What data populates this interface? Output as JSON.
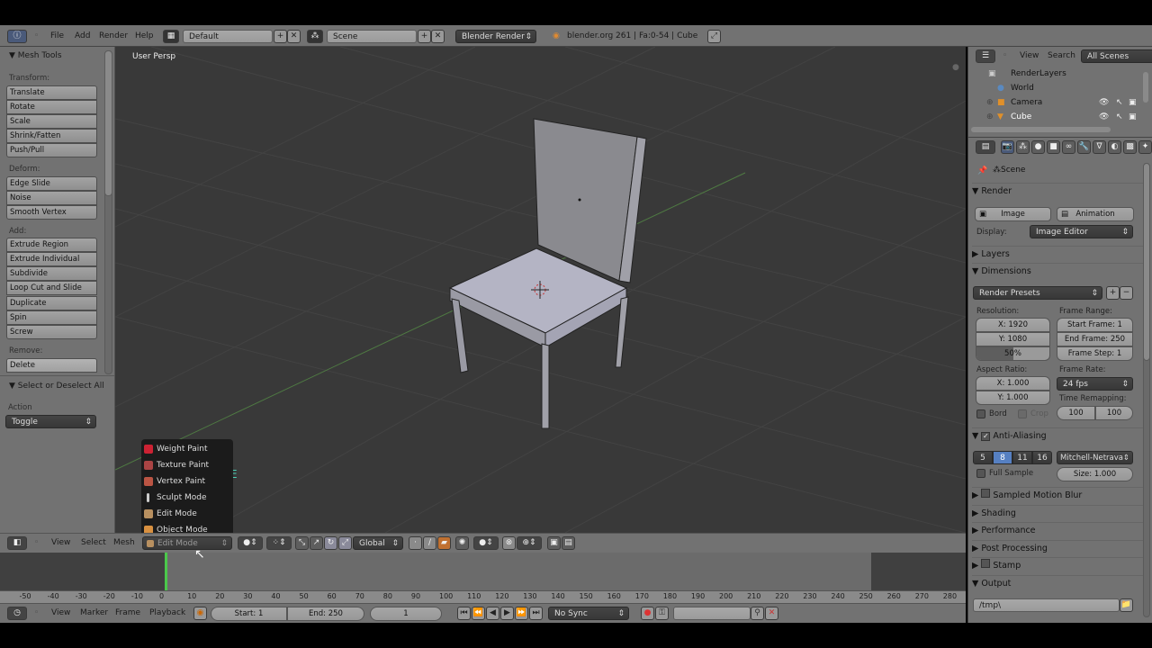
{
  "top_header": {
    "menus": [
      "File",
      "Add",
      "Render",
      "Help"
    ],
    "screen_layout": "Default",
    "scene": "Scene",
    "render_engine": "Blender Render",
    "info_text": "blender.org 261 | Fa:0-54 | Cube"
  },
  "tool_shelf": {
    "title": "Mesh Tools",
    "sections": [
      {
        "label": "Transform:",
        "buttons": [
          "Translate",
          "Rotate",
          "Scale",
          "Shrink/Fatten",
          "Push/Pull"
        ]
      },
      {
        "label": "Deform:",
        "buttons": [
          "Edge Slide",
          "Noise",
          "Smooth Vertex"
        ]
      },
      {
        "label": "Add:",
        "buttons": [
          "Extrude Region",
          "Extrude Individual",
          "Subdivide",
          "Loop Cut and Slide",
          "Duplicate",
          "Spin",
          "Screw"
        ]
      },
      {
        "label": "Remove:",
        "buttons": [
          "Delete"
        ]
      }
    ],
    "operator_panel": {
      "title": "Select or Deselect All",
      "action_label": "Action",
      "action_value": "Toggle"
    }
  },
  "viewport": {
    "view_label": "User Persp",
    "overlay_letter": "E"
  },
  "mode_menu": {
    "items": [
      "Weight Paint",
      "Texture Paint",
      "Vertex Paint",
      "Sculpt Mode",
      "Edit Mode",
      "Object Mode"
    ]
  },
  "viewport_header": {
    "menus": [
      "View",
      "Select",
      "Mesh"
    ],
    "mode": "Edit Mode",
    "orientation": "Global"
  },
  "timeline": {
    "ruler_ticks": [
      "-50",
      "-40",
      "-30",
      "-20",
      "-10",
      "0",
      "10",
      "20",
      "30",
      "40",
      "50",
      "60",
      "70",
      "80",
      "90",
      "100",
      "110",
      "120",
      "130",
      "140",
      "150",
      "160",
      "170",
      "180",
      "190",
      "200",
      "210",
      "220",
      "230",
      "240",
      "250",
      "260",
      "270",
      "280"
    ],
    "menus": [
      "View",
      "Marker",
      "Frame",
      "Playback"
    ],
    "start": "Start: 1",
    "end": "End: 250",
    "current_frame": "1",
    "sync": "No Sync"
  },
  "outliner": {
    "menus": [
      "View",
      "Search"
    ],
    "filter": "All Scenes",
    "items": [
      "RenderLayers",
      "World",
      "Camera",
      "Cube"
    ]
  },
  "properties": {
    "context": "Scene",
    "render": {
      "title": "Render",
      "image_btn": "Image",
      "animation_btn": "Animation",
      "display_label": "Display:",
      "display_value": "Image Editor"
    },
    "layers_title": "Layers",
    "dimensions": {
      "title": "Dimensions",
      "presets": "Render Presets",
      "resolution_label": "Resolution:",
      "res_x": "X: 1920",
      "res_y": "Y: 1080",
      "res_pct": "50%",
      "res_pct_value": 0.5,
      "frame_range_label": "Frame Range:",
      "start_frame": "Start Frame: 1",
      "end_frame": "End Frame: 250",
      "frame_step": "Frame Step: 1",
      "aspect_label": "Aspect Ratio:",
      "aspect_x": "X: 1.000",
      "aspect_y": "Y: 1.000",
      "frame_rate_label": "Frame Rate:",
      "frame_rate": "24 fps",
      "time_remap_label": "Time Remapping:",
      "remap_old": "100",
      "remap_new": "100",
      "border": "Bord",
      "crop": "Crop"
    },
    "anti_aliasing": {
      "title": "Anti-Aliasing",
      "samples": [
        "5",
        "8",
        "11",
        "16"
      ],
      "selected": "8",
      "filter": "Mitchell-Netrava",
      "full_sample": "Full Sample",
      "size": "Size: 1.000"
    },
    "collapsed_panels": [
      "Sampled Motion Blur",
      "Shading",
      "Performance",
      "Post Processing",
      "Stamp"
    ],
    "output": {
      "title": "Output",
      "path": "/tmp\\"
    }
  }
}
